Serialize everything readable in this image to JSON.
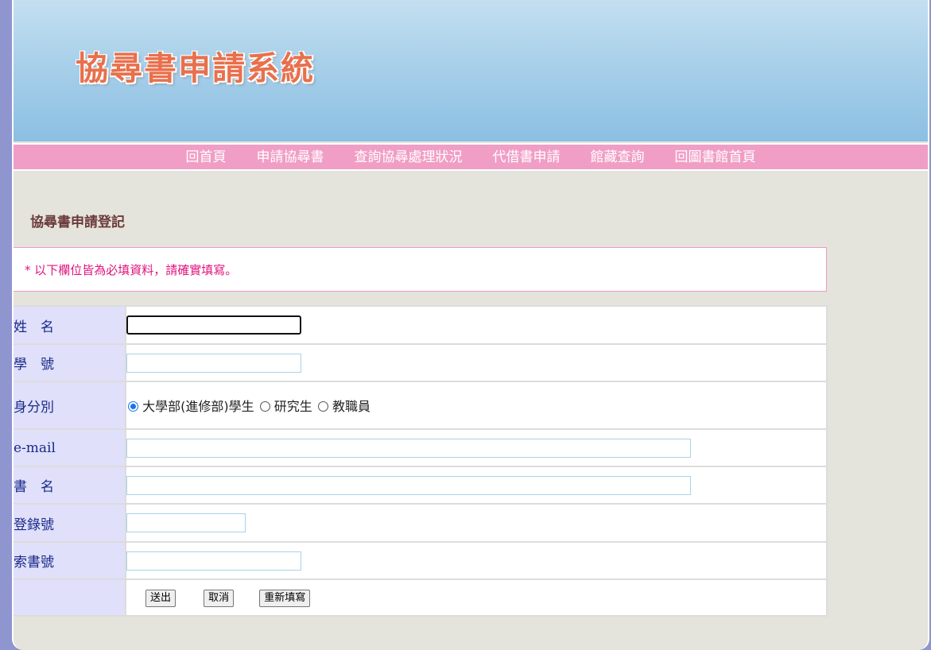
{
  "header": {
    "title": "協尋書申請系統"
  },
  "nav": {
    "items": [
      "回首頁",
      "申請協尋書",
      "查詢協尋處理狀況",
      "代借書申請",
      "館藏查詢",
      "回圖書館首頁"
    ]
  },
  "form": {
    "section_title": "協尋書申請登記",
    "notice": "* 以下欄位皆為必填資料，請確實填寫。",
    "fields": {
      "name_label": "姓　名",
      "student_id_label": "學　號",
      "identity_label": "身分別",
      "identity_options": [
        "大學部(進修部)學生",
        "研究生",
        "教職員"
      ],
      "identity_selected": "大學部(進修部)學生",
      "email_label": "e-mail",
      "book_title_label": "書　名",
      "accession_label": "登錄號",
      "call_number_label": "索書號"
    },
    "buttons": {
      "submit": "送出",
      "cancel": "取消",
      "reset": "重新填寫"
    }
  },
  "colors": {
    "banner_title": "#e8704c",
    "nav_bg": "#f09ec6",
    "label_bg": "#e0e0fa",
    "label_text": "#1a2a8a",
    "notice_text": "#e0147e",
    "page_bg": "#e4e4dc",
    "outer_bg": "#8f95cf"
  }
}
